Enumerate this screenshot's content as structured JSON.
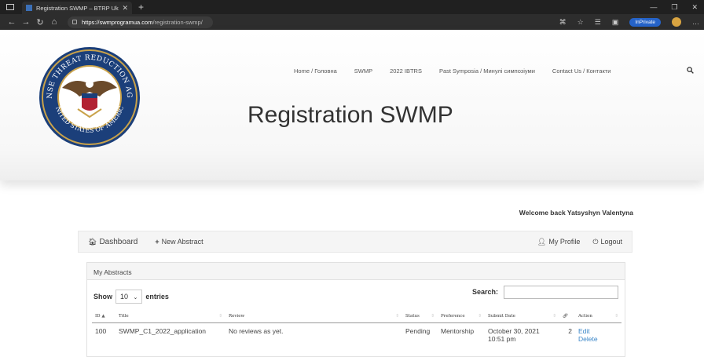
{
  "browser": {
    "tab_title": "Registration SWMP – BTRP Ukra",
    "url_host": "https://swmprogramua.com",
    "url_path": "/registration-swmp/",
    "inprivate_label": "InPrivate"
  },
  "site": {
    "logo_text_top": "DEFENSE THREAT REDUCTION AGENCY",
    "logo_text_bottom": "UNITED STATES OF AMERICA",
    "menu": [
      "Home / Головна",
      "SWMP",
      "2022 IBTRS",
      "Past Symposia / Минулі симпозіуми",
      "Contact Us / Контакти"
    ],
    "page_title": "Registration SWMP",
    "welcome": "Welcome back Yatsyshyn Valentyna"
  },
  "dashboard": {
    "dashboard_label": "Dashboard",
    "new_abstract_label": "New Abstract",
    "profile_label": "My Profile",
    "logout_label": "Logout"
  },
  "abstracts": {
    "panel_title": "My Abstracts",
    "show_label": "Show",
    "entries_value": "10",
    "entries_label": "entries",
    "search_label": "Search:",
    "columns": [
      "ID",
      "Title",
      "Review",
      "Status",
      "Preference",
      "Submit Date",
      "Action"
    ],
    "rows": [
      {
        "id": "100",
        "title": "SWMP_C1_2022_application",
        "review": "No reviews as yet.",
        "status": "Pending",
        "preference": "Mentorship",
        "date": "October 30, 2021",
        "time": "10:51 pm",
        "count": "2",
        "edit": "Edit",
        "delete": "Delete"
      }
    ]
  }
}
